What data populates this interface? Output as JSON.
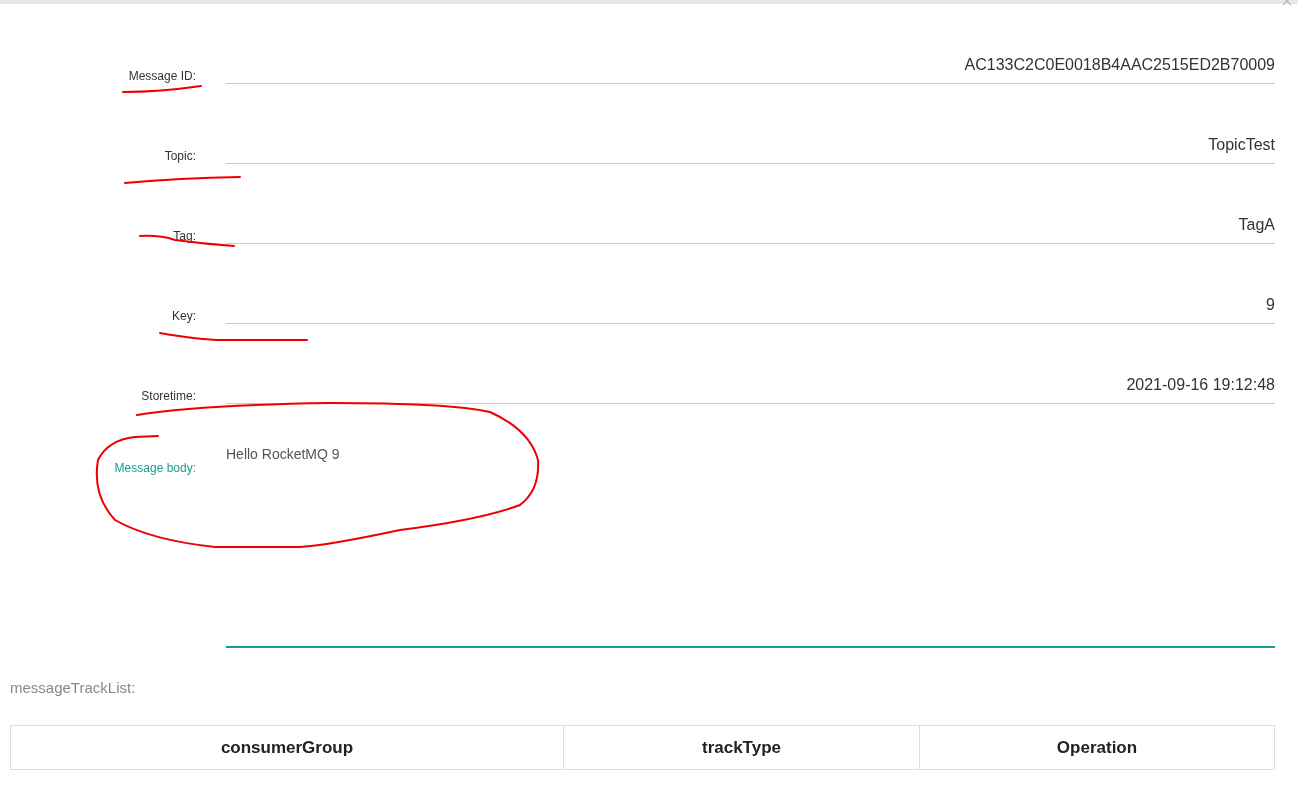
{
  "fields": [
    {
      "label": "Message ID:",
      "value": "AC133C2C0E0018B4AAC2515ED2B70009"
    },
    {
      "label": "Topic:",
      "value": "TopicTest"
    },
    {
      "label": "Tag:",
      "value": "TagA"
    },
    {
      "label": "Key:",
      "value": "9"
    },
    {
      "label": "Storetime:",
      "value": "2021-09-16 19:12:48"
    }
  ],
  "message_body": {
    "label": "Message body:",
    "value": "Hello RocketMQ 9"
  },
  "track_list": {
    "title": "messageTrackList:",
    "columns": [
      "consumerGroup",
      "trackType",
      "Operation"
    ]
  }
}
